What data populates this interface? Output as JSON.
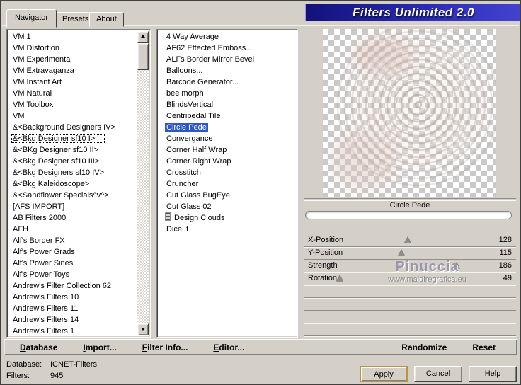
{
  "window": {
    "title": "Filters Unlimited 2.0",
    "tabs": [
      {
        "label": "Navigator",
        "active": true
      },
      {
        "label": "Presets",
        "active": false
      },
      {
        "label": "About",
        "active": false
      }
    ]
  },
  "categories": {
    "selected_index": 9,
    "items": [
      "VM 1",
      "VM Distortion",
      "VM Experimental",
      "VM Extravaganza",
      "VM Instant Art",
      "VM Natural",
      "VM Toolbox",
      "VM",
      "&<Background Designers IV>",
      "&<Bkg Designer sf10 I>",
      "&<BKg Designer sf10 II>",
      "&<Bkg Designer sf10 III>",
      "&<Bkg Designers sf10 IV>",
      "&<Bkg Kaleidoscope>",
      "&<Sandflower Specials^v^>",
      "[AFS IMPORT]",
      "AB Filters 2000",
      "AFH",
      "Alf's Border FX",
      "Alf's Power Grads",
      "Alf's Power Sines",
      "Alf's Power Toys",
      "Andrew's Filter Collection 62",
      "Andrew's Filters 10",
      "Andrew's Filters 11",
      "Andrew's Filters 14",
      "Andrew's Filters 1"
    ]
  },
  "filters": {
    "selected_index": 8,
    "icon_item_index": 16,
    "items": [
      "4 Way Average",
      "AF62 Effected Emboss...",
      "ALFs Border Mirror Bevel",
      "Balloons...",
      "Barcode Generator...",
      "bee morph",
      "BlindsVertical",
      "Centripedal Tile",
      "Circle Pede",
      "Convergance",
      "Corner Half Wrap",
      "Corner Right Wrap",
      "Crosstitch",
      "Cruncher",
      "Cut Glass  BugEye",
      "Cut Glass 02",
      "Design Clouds",
      "Dice It"
    ]
  },
  "preview": {
    "selected_filter_label": "Circle Pede",
    "progress_percent": 0
  },
  "parameters": {
    "rows": [
      {
        "label": "X-Position",
        "value": "128",
        "pos_percent": 49
      },
      {
        "label": "Y-Position",
        "value": "115",
        "pos_percent": 46
      },
      {
        "label": "Strength",
        "value": "186",
        "pos_percent": 72
      },
      {
        "label": "Rotation",
        "value": "49",
        "pos_percent": 17
      }
    ],
    "empty_row_count": 4
  },
  "watermark": {
    "name": "Pinuccia",
    "url": "www.maidiregrafica.eu"
  },
  "menubar": {
    "items_left": [
      {
        "label": "Database"
      },
      {
        "label": "Import..."
      },
      {
        "label": "Filter Info..."
      },
      {
        "label": "Editor..."
      }
    ],
    "items_right": [
      {
        "label": "Randomize"
      },
      {
        "label": "Reset"
      }
    ]
  },
  "status": {
    "database_label": "Database:",
    "database_value": "ICNET-Filters",
    "filters_label": "Filters:",
    "filters_value": "945"
  },
  "action_buttons": {
    "apply": "Apply",
    "cancel": "Cancel",
    "help": "Help"
  },
  "colors": {
    "selection": "#2e57c6",
    "banner_start": "#12127a",
    "banner_end": "#4343cf",
    "window_bg": "#d4d0c8"
  }
}
